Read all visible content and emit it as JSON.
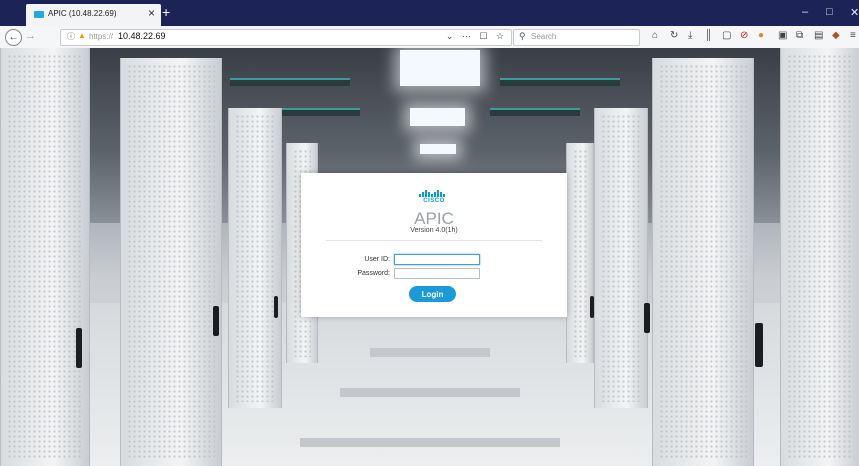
{
  "browser": {
    "tab": {
      "title": "APIC (10.48.22.69)"
    },
    "new_tab": "+",
    "window": {
      "minimize": "‒",
      "maximize": "□",
      "close": "✕"
    },
    "nav": {
      "back": "←",
      "forward": "→"
    },
    "url": {
      "protocol": "https://",
      "host": "10.48.22.69"
    },
    "search": {
      "placeholder": "Search"
    },
    "toolbar_icons": [
      "home-icon",
      "reload-icon",
      "download-icon",
      "library-icon",
      "sidebar-icon",
      "adblock-icon",
      "extension-icon",
      "screenshot-icon",
      "reader-icon",
      "bookmark-icon",
      "menu-icon"
    ]
  },
  "login": {
    "brand": "CISCO",
    "product": "APIC",
    "version": "Version 4.0(1h)",
    "user_label": "User ID:",
    "user_value": "",
    "password_label": "Password:",
    "password_value": "",
    "button": "Login",
    "accent": "#1a9ad6"
  }
}
